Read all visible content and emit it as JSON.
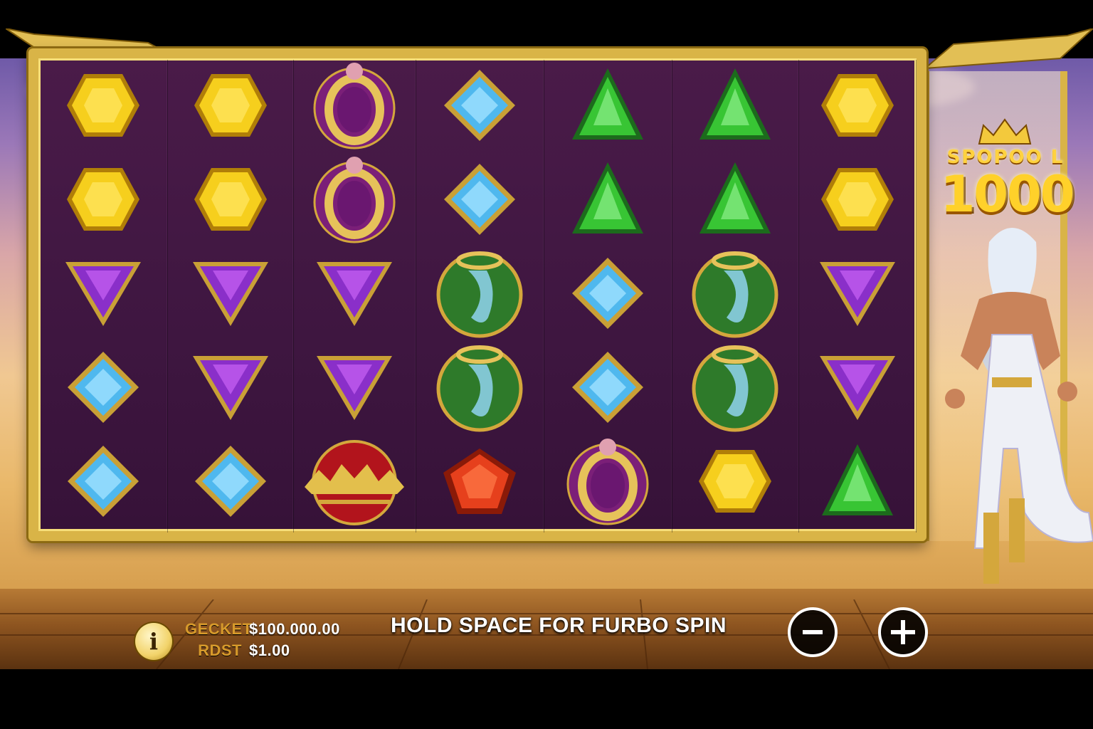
{
  "game": {
    "logo_word": "SPOPOO L",
    "logo_number": "1000"
  },
  "reels": [
    [
      "yellow-hexagon-gem",
      "yellow-hexagon-gem",
      "purple-triangle-gem",
      "blue-diamond-gem",
      "blue-diamond-gem"
    ],
    [
      "yellow-hexagon-gem",
      "yellow-hexagon-gem",
      "purple-triangle-gem",
      "purple-triangle-gem",
      "blue-diamond-gem"
    ],
    [
      "gold-ring",
      "gold-ring",
      "purple-triangle-gem",
      "purple-triangle-gem",
      "red-crown"
    ],
    [
      "blue-diamond-gem",
      "blue-diamond-gem",
      "green-hourglass",
      "green-hourglass",
      "red-pentagon-gem"
    ],
    [
      "green-triangle-gem",
      "green-triangle-gem",
      "blue-diamond-gem",
      "blue-diamond-gem",
      "gold-ring"
    ],
    [
      "green-triangle-gem",
      "green-triangle-gem",
      "green-hourglass",
      "green-hourglass",
      "yellow-hexagon-gem"
    ],
    [
      "yellow-hexagon-gem",
      "yellow-hexagon-gem",
      "purple-triangle-gem",
      "purple-triangle-gem",
      "green-triangle-gem"
    ]
  ],
  "bottom_bar": {
    "info_icon": "i",
    "credit_label": "GECKET",
    "credit_value": "$100.000.00",
    "bet_label": "RDST",
    "bet_value": "$1.00",
    "message": "HOLD SPACE FOR FURBO SPIN",
    "decrease_icon": "minus-icon",
    "increase_icon": "plus-icon"
  },
  "colors": {
    "frame_gold": "#d9b447",
    "grid_background": "#4a1b49",
    "label_orange": "#d79a2b",
    "text_white": "#ffffff"
  }
}
